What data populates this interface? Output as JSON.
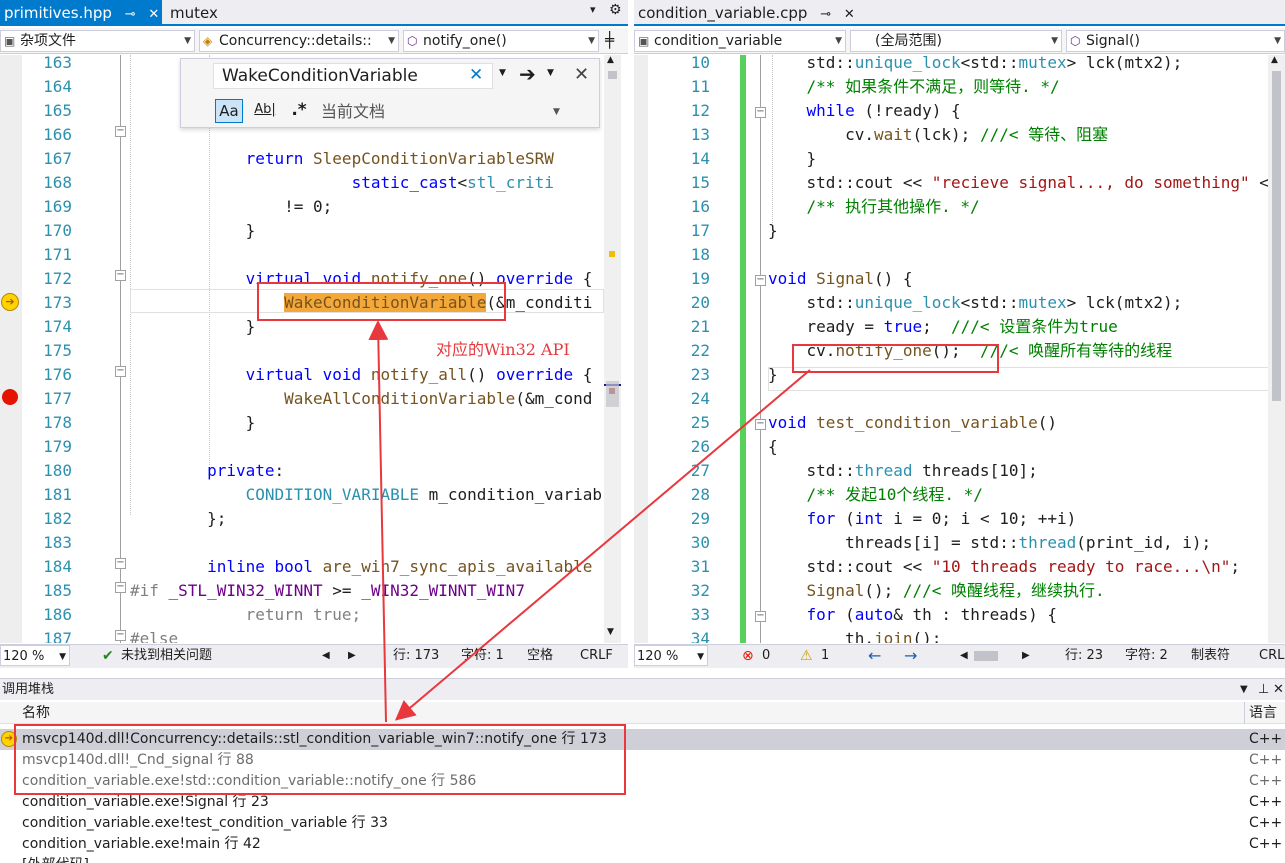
{
  "left_tabs": [
    {
      "label": "primitives.hpp",
      "active": true
    },
    {
      "label": "mutex",
      "active": false
    }
  ],
  "right_tabs": [
    {
      "label": "condition_variable.cpp",
      "active": false
    }
  ],
  "left_nav": {
    "project": "杂项文件",
    "scope": "Concurrency::details::",
    "member": "notify_one()"
  },
  "right_nav": {
    "project": "condition_variable",
    "scope": "(全局范围)",
    "member": "Signal()"
  },
  "find": {
    "query": "WakeConditionVariable",
    "opt_case": "Aa",
    "opt_word": "Ab|",
    "opt_regex": ".*",
    "scope": "当前文档"
  },
  "left_code": [
    {
      "n": "163",
      "t": [
        [
          "",
          ""
        ]
      ]
    },
    {
      "n": "164",
      "t": [
        [
          "",
          ""
        ]
      ]
    },
    {
      "n": "165",
      "t": [
        [
          "",
          ""
        ]
      ]
    },
    {
      "n": "166",
      "t": [
        [
          "",
          "        "
        ]
      ]
    },
    {
      "n": "167",
      "t": [
        [
          "kw",
          "            return "
        ],
        [
          "fn",
          "SleepConditionVariableSRW"
        ]
      ]
    },
    {
      "n": "168",
      "t": [
        [
          "",
          "                       "
        ],
        [
          "kw",
          "static_cast"
        ],
        [
          "",
          "<"
        ],
        [
          "ty",
          "stl_criti"
        ]
      ]
    },
    {
      "n": "169",
      "t": [
        [
          "",
          "                "
        ],
        [
          "",
          "!= 0;"
        ]
      ]
    },
    {
      "n": "170",
      "t": [
        [
          "",
          "            }"
        ]
      ]
    },
    {
      "n": "171",
      "t": [
        [
          "",
          ""
        ]
      ]
    },
    {
      "n": "172",
      "t": [
        [
          "kw",
          "            virtual void "
        ],
        [
          "fn",
          "notify_one"
        ],
        [
          "",
          "() "
        ],
        [
          "kw",
          "override"
        ],
        [
          "",
          " {"
        ]
      ]
    },
    {
      "n": "173",
      "t": [
        [
          "",
          "                "
        ],
        [
          "hl",
          "WakeConditionVariable"
        ],
        [
          "",
          "(&m_conditi"
        ]
      ]
    },
    {
      "n": "174",
      "t": [
        [
          "",
          "            }"
        ]
      ]
    },
    {
      "n": "175",
      "t": [
        [
          "",
          ""
        ]
      ]
    },
    {
      "n": "176",
      "t": [
        [
          "kw",
          "            virtual void "
        ],
        [
          "fn",
          "notify_all"
        ],
        [
          "",
          "() "
        ],
        [
          "kw",
          "override"
        ],
        [
          "",
          " {"
        ]
      ]
    },
    {
      "n": "177",
      "t": [
        [
          "",
          "                "
        ],
        [
          "fn",
          "WakeAllConditionVariable"
        ],
        [
          "",
          "(&m_cond"
        ]
      ]
    },
    {
      "n": "178",
      "t": [
        [
          "",
          "            }"
        ]
      ]
    },
    {
      "n": "179",
      "t": [
        [
          "",
          ""
        ]
      ]
    },
    {
      "n": "180",
      "t": [
        [
          "kw",
          "        private"
        ],
        [
          "",
          ":"
        ]
      ]
    },
    {
      "n": "181",
      "t": [
        [
          "ty",
          "            CONDITION_VARIABLE"
        ],
        [
          "",
          " m_condition_variab"
        ]
      ]
    },
    {
      "n": "182",
      "t": [
        [
          "",
          "        };"
        ]
      ]
    },
    {
      "n": "183",
      "t": [
        [
          "",
          ""
        ]
      ]
    },
    {
      "n": "184",
      "t": [
        [
          "kw",
          "        inline bool "
        ],
        [
          "fn",
          "are_win7_sync_apis_available"
        ]
      ]
    },
    {
      "n": "185",
      "t": [
        [
          "pp",
          "#if "
        ],
        [
          "mac",
          "_STL_WIN32_WINNT"
        ],
        [
          "",
          " >= "
        ],
        [
          "mac",
          "_WIN32_WINNT_WIN7"
        ]
      ]
    },
    {
      "n": "186",
      "t": [
        [
          "pp",
          "            return true;"
        ]
      ]
    },
    {
      "n": "187",
      "t": [
        [
          "pp",
          "#else"
        ]
      ]
    }
  ],
  "right_code": [
    {
      "n": "10",
      "t": [
        [
          "",
          "    std::"
        ],
        [
          "ty",
          "unique_lock"
        ],
        [
          "",
          "<std::"
        ],
        [
          "ty",
          "mutex"
        ],
        [
          "",
          "> lck(mtx2);"
        ]
      ]
    },
    {
      "n": "11",
      "t": [
        [
          "cm",
          "    /** 如果条件不满足，则等待. */"
        ]
      ]
    },
    {
      "n": "12",
      "t": [
        [
          "kw",
          "    while"
        ],
        [
          "",
          " (!ready) {"
        ]
      ]
    },
    {
      "n": "13",
      "t": [
        [
          "",
          "        cv."
        ],
        [
          "fn",
          "wait"
        ],
        [
          "",
          "(lck); "
        ],
        [
          "cm",
          "///< 等待、阻塞"
        ]
      ]
    },
    {
      "n": "14",
      "t": [
        [
          "",
          "    }"
        ]
      ]
    },
    {
      "n": "15",
      "t": [
        [
          "",
          "    std::cout << "
        ],
        [
          "str",
          "\"recieve signal..., do something\""
        ],
        [
          "",
          " <<"
        ]
      ]
    },
    {
      "n": "16",
      "t": [
        [
          "cm",
          "    /** 执行其他操作. */"
        ]
      ]
    },
    {
      "n": "17",
      "t": [
        [
          "",
          "}"
        ]
      ]
    },
    {
      "n": "18",
      "t": [
        [
          "",
          ""
        ]
      ]
    },
    {
      "n": "19",
      "t": [
        [
          "kw",
          "void "
        ],
        [
          "fn",
          "Signal"
        ],
        [
          "",
          "() {"
        ]
      ]
    },
    {
      "n": "20",
      "t": [
        [
          "",
          "    std::"
        ],
        [
          "ty",
          "unique_lock"
        ],
        [
          "",
          "<std::"
        ],
        [
          "ty",
          "mutex"
        ],
        [
          "",
          "> lck(mtx2);"
        ]
      ]
    },
    {
      "n": "21",
      "t": [
        [
          "",
          "    ready = "
        ],
        [
          "kw",
          "true"
        ],
        [
          "",
          ";  "
        ],
        [
          "cm",
          "///< 设置条件为true"
        ]
      ]
    },
    {
      "n": "22",
      "t": [
        [
          "",
          "    cv."
        ],
        [
          "fn",
          "notify_one"
        ],
        [
          "",
          "();  "
        ],
        [
          "cm",
          "///< 唤醒所有等待的线程"
        ]
      ]
    },
    {
      "n": "23",
      "t": [
        [
          "",
          "}"
        ]
      ]
    },
    {
      "n": "24",
      "t": [
        [
          "",
          ""
        ]
      ]
    },
    {
      "n": "25",
      "t": [
        [
          "kw",
          "void "
        ],
        [
          "fn",
          "test_condition_variable"
        ],
        [
          "",
          "()"
        ]
      ]
    },
    {
      "n": "26",
      "t": [
        [
          "",
          "{"
        ]
      ]
    },
    {
      "n": "27",
      "t": [
        [
          "",
          "    std::"
        ],
        [
          "ty",
          "thread"
        ],
        [
          "",
          " threads[10];"
        ]
      ]
    },
    {
      "n": "28",
      "t": [
        [
          "cm",
          "    /** 发起10个线程. */"
        ]
      ]
    },
    {
      "n": "29",
      "t": [
        [
          "kw",
          "    for"
        ],
        [
          "",
          " ("
        ],
        [
          "kw",
          "int"
        ],
        [
          "",
          " i = 0; i < 10; ++i)"
        ]
      ]
    },
    {
      "n": "30",
      "t": [
        [
          "",
          "        threads[i] = std::"
        ],
        [
          "ty",
          "thread"
        ],
        [
          "",
          "(print_id, i);"
        ]
      ]
    },
    {
      "n": "31",
      "t": [
        [
          "",
          "    std::cout << "
        ],
        [
          "str",
          "\"10 threads ready to race...\\n\""
        ],
        [
          "",
          ";"
        ]
      ]
    },
    {
      "n": "32",
      "t": [
        [
          "",
          "    "
        ],
        [
          "fn",
          "Signal"
        ],
        [
          "",
          "(); "
        ],
        [
          "cm",
          "///< 唤醒线程，继续执行."
        ]
      ]
    },
    {
      "n": "33",
      "t": [
        [
          "kw",
          "    for"
        ],
        [
          "",
          " ("
        ],
        [
          "kw",
          "auto"
        ],
        [
          "",
          "& th : threads) {"
        ]
      ]
    },
    {
      "n": "34",
      "t": [
        [
          "",
          "        th."
        ],
        [
          "fn",
          "join"
        ],
        [
          "",
          "();"
        ]
      ]
    }
  ],
  "left_status": {
    "zoom": "120 %",
    "issues": "未找到相关问题",
    "row": "行: 173",
    "col": "字符: 1",
    "ws": "空格",
    "eol": "CRLF"
  },
  "right_status": {
    "zoom": "120 %",
    "errors": "0",
    "warnings": "1",
    "row": "行: 23",
    "col": "字符: 2",
    "ws": "制表符",
    "eol": "CRL"
  },
  "callstack": {
    "title": "调用堆栈",
    "col_name": "名称",
    "col_lang": "语言",
    "rows": [
      {
        "name": "msvcp140d.dll!Concurrency::details::stl_condition_variable_win7::notify_one 行 173",
        "lang": "C++"
      },
      {
        "name": "msvcp140d.dll!_Cnd_signal 行 88",
        "lang": "C++"
      },
      {
        "name": "condition_variable.exe!std::condition_variable::notify_one 行 586",
        "lang": "C++"
      },
      {
        "name": "condition_variable.exe!Signal 行 23",
        "lang": "C++"
      },
      {
        "name": "condition_variable.exe!test_condition_variable 行 33",
        "lang": "C++"
      },
      {
        "name": "condition_variable.exe!main 行 42",
        "lang": "C++"
      },
      {
        "name": "[外部代码]",
        "lang": ""
      }
    ]
  },
  "annotation": "对应的Win32 API",
  "colors": {
    "accent": "#007acc",
    "annot": "#e8383d",
    "breakpoint": "#e51400",
    "change_bar": "#57d15b"
  }
}
